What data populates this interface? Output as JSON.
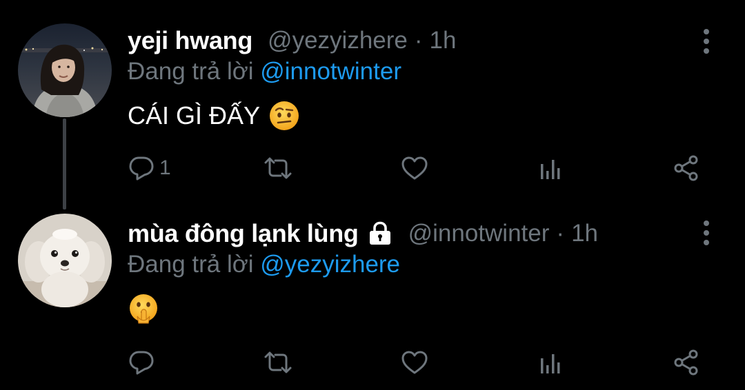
{
  "colors": {
    "background": "#000000",
    "name": "#ffffff",
    "muted": "#6e767d",
    "link": "#1d9bf0",
    "thread_line": "#3d4146"
  },
  "tweets": [
    {
      "display_name": "yeji hwang",
      "handle": "@yezyizhere",
      "separator": "·",
      "time": "1h",
      "reply_prefix": "Đang trả lời",
      "reply_to": "@innotwinter",
      "text": "CÁI GÌ ĐẤY",
      "emoji_icon": "face-with-raised-eyebrow-icon",
      "avatar": "girl-portrait-avatar",
      "protected": false,
      "actions": {
        "reply_count": "1",
        "retweet_count": "",
        "like_count": ""
      }
    },
    {
      "display_name": "mùa đông lạnk lùng",
      "handle": "@innotwinter",
      "separator": "·",
      "time": "1h",
      "reply_prefix": "Đang trả lời",
      "reply_to": "@yezyizhere",
      "text": "",
      "emoji_icon": "shushing-face-icon",
      "avatar": "white-puppy-avatar",
      "protected": true,
      "actions": {
        "reply_count": "",
        "retweet_count": "",
        "like_count": ""
      }
    }
  ]
}
